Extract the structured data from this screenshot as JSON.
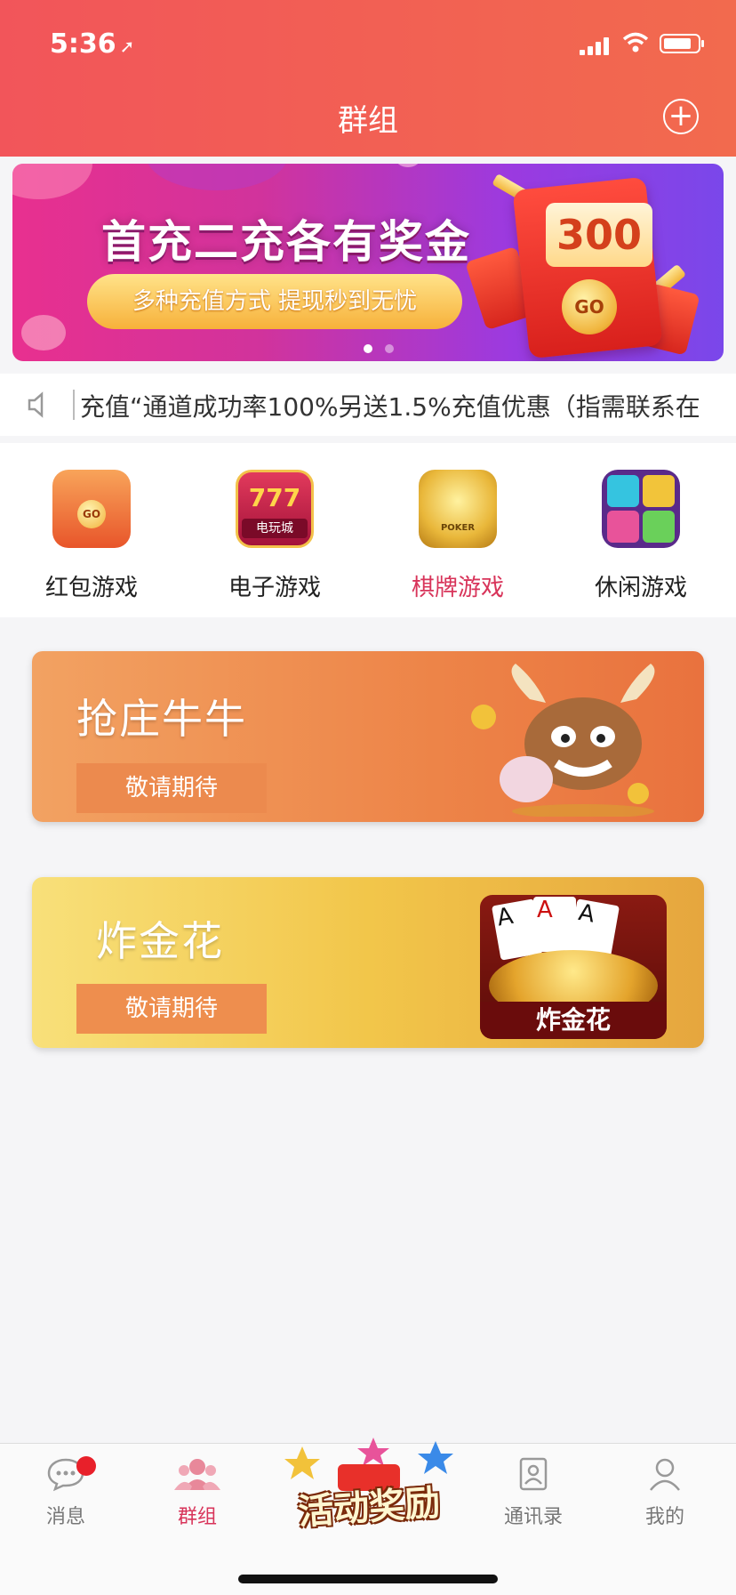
{
  "status_bar": {
    "time": "5:36"
  },
  "header": {
    "title": "群组"
  },
  "banner": {
    "title": "首充二充各有奖金",
    "subtitle": "多种充值方式  提现秒到无忧",
    "amount": "300",
    "go_text": "GO",
    "page_count": 2,
    "active_page": 1
  },
  "notice": {
    "text": "充值“通道成功率100%另送1.5%充值优惠（指需联系在"
  },
  "categories": [
    {
      "label": "红包游戏",
      "icon": "red-envelope-icon",
      "badge": "GO",
      "active": false
    },
    {
      "label": "电子游戏",
      "icon": "slot-777-icon",
      "badge": "电玩城",
      "active": false
    },
    {
      "label": "棋牌游戏",
      "icon": "poker-chip-icon",
      "badge": "POKER",
      "active": true
    },
    {
      "label": "休闲游戏",
      "icon": "gem-blocks-icon",
      "active": false
    }
  ],
  "game_cards": [
    {
      "name": "抢庄牛牛",
      "button": "敬请期待",
      "art": "bull-mascot-icon"
    },
    {
      "name": "炸金花",
      "button": "敬请期待",
      "art": "card-aces-icon",
      "logo_text": "炸金花"
    }
  ],
  "tabbar": {
    "items": [
      {
        "label": "消息",
        "icon": "chat-bubble-icon",
        "has_badge": true
      },
      {
        "label": "群组",
        "icon": "group-icon",
        "active": true
      },
      {
        "label": "通讯录",
        "icon": "contacts-icon"
      },
      {
        "label": "我的",
        "icon": "profile-icon"
      }
    ],
    "promo_text": "活动奖励"
  },
  "colors": {
    "header": "#f2555a",
    "active_tab": "#d8345a",
    "card_orange": "#ee8e4e",
    "card_gold": "#f3c84c"
  }
}
